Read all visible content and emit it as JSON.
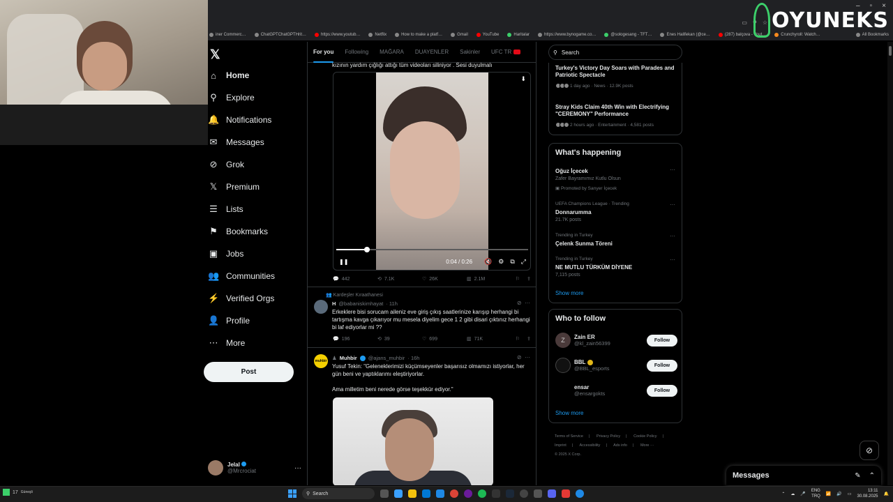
{
  "browser": {
    "window_controls": [
      "–",
      "▫",
      "×"
    ],
    "bookmarks": [
      "iner Commerc…",
      "ChatGPTChatGPTHrit…",
      "https://www.youtub…",
      "Netflix",
      "How to make a platf…",
      "Gmail",
      "YouTube",
      "Haritalar",
      "https://www.bynogame.co…",
      "@sologesang - TFT…",
      "Enes Halifekan (@ce…",
      "(287) balçova - Yout…",
      "Crunchyroll: Watch…",
      "All Bookmarks"
    ]
  },
  "overlay": {
    "brand": "OYUNEKS"
  },
  "nav": {
    "logo": "𝕏",
    "items": [
      {
        "label": "Home",
        "icon": "⌂",
        "active": true
      },
      {
        "label": "Explore",
        "icon": "⚲"
      },
      {
        "label": "Notifications",
        "icon": "🔔"
      },
      {
        "label": "Messages",
        "icon": "✉"
      },
      {
        "label": "Grok",
        "icon": "⊘"
      },
      {
        "label": "Premium",
        "icon": "𝕏"
      },
      {
        "label": "Lists",
        "icon": "☰"
      },
      {
        "label": "Bookmarks",
        "icon": "⚑"
      },
      {
        "label": "Jobs",
        "icon": "▣"
      },
      {
        "label": "Communities",
        "icon": "👥"
      },
      {
        "label": "Verified Orgs",
        "icon": "⚡"
      },
      {
        "label": "Profile",
        "icon": "👤"
      },
      {
        "label": "More",
        "icon": "⋯"
      }
    ],
    "post_label": "Post",
    "user_name": "Jelal",
    "user_handle": "@Mrcrociat",
    "user_more": "···"
  },
  "feed": {
    "tabs": [
      "For you",
      "Following",
      "MAĞARA",
      "DUAYENLER",
      "Sakinler",
      "UFC TR"
    ],
    "tweet1": {
      "cut_text": "kızının yardım çığlığı attığı tüm videoları siliniyor . Sesi duyulmalı",
      "video_time": "0:04 / 0:26",
      "progress": 0.16,
      "replies": "442",
      "reposts": "7.1K",
      "likes": "26K",
      "views": "2.1M"
    },
    "tweet2": {
      "context": "Kardeşler Kıraathanesi",
      "name": "H",
      "handle": "@babaniskimhayat",
      "time": "· 11h",
      "body": "Erkeklere bisi sorucam aileniz eve giriş çıkış saatlerinize karışıp herhangi bi tartışma kavga çıkarıyor mu mesela diyelim gece 1 2 gibi disari çıktınız herhangi bi laf ediyorlar mi ??",
      "replies": "196",
      "reposts": "39",
      "likes": "699",
      "views": "71K"
    },
    "tweet3": {
      "name": "Muhbir",
      "handle": "@ajans_muhbir",
      "time": "· 16h",
      "avatar_text": "muhbir",
      "body1": "Yusuf Tekin: \"Geleneklerimizi küçümseyenler başarısız olmamızı istiyorlar, her gün beni ve yaptıklarımı eleştiriyorlar.",
      "body2": "Ama milletim beni nerede görse teşekkür ediyor.\""
    }
  },
  "right": {
    "search_placeholder": "Search",
    "news": [
      {
        "title": "Turkey's Victory Day Soars with Parades and Patriotic Spectacle",
        "meta": "1 day ago · News · 12.9K posts"
      },
      {
        "title": "Stray Kids Claim 40th Win with Electrifying \"CEREMONY\" Performance",
        "meta": "2 hours ago · Entertainment · 4,581 posts"
      }
    ],
    "whats_happening_title": "What's happening",
    "trends": [
      {
        "cat": "",
        "name": "Oğuz İçecek",
        "sub": "Zafer Bayramımız Kutlu Olsun",
        "promo": "Promoted by Sarıyer İçecek"
      },
      {
        "cat": "UEFA Champions League · Trending",
        "name": "Donnarumma",
        "sub": "21.7K posts"
      },
      {
        "cat": "Trending in Turkey",
        "name": "Çelenk Sunma Töreni",
        "sub": ""
      },
      {
        "cat": "Trending in Turkey",
        "name": "NE MUTLU TÜRKÜM DİYENE",
        "sub": "7,115 posts"
      }
    ],
    "show_more": "Show more",
    "who_to_follow_title": "Who to follow",
    "follows": [
      {
        "name": "Zain ER",
        "handle": "@kl_zain56399",
        "initial": "Z",
        "badge": ""
      },
      {
        "name": "BBL",
        "handle": "@BBL_esports",
        "initial": "",
        "badge": "gold"
      },
      {
        "name": "ensar",
        "handle": "@ensargokts",
        "initial": "",
        "badge": ""
      }
    ],
    "follow_label": "Follow",
    "footer": [
      "Terms of Service",
      "|",
      "Privacy Policy",
      "|",
      "Cookie Policy",
      "|",
      "Imprint",
      "|",
      "Accessibility",
      "|",
      "Ads info",
      "|",
      "More ···",
      "© 2025 X Corp."
    ]
  },
  "dock": {
    "messages_title": "Messages"
  },
  "taskbar": {
    "weather": "17",
    "weather_sub": "Güneşli",
    "search": "Search",
    "lang": "ENG",
    "lang_sub": "TRQ",
    "time": "13:11",
    "date": "30.08.2025"
  },
  "colors": {
    "accent": "#1d9bf0",
    "background": "#000000",
    "text": "#e7e9ea",
    "muted": "#71767b",
    "border": "#2f3336",
    "brand_green": "#3ccf6a"
  }
}
